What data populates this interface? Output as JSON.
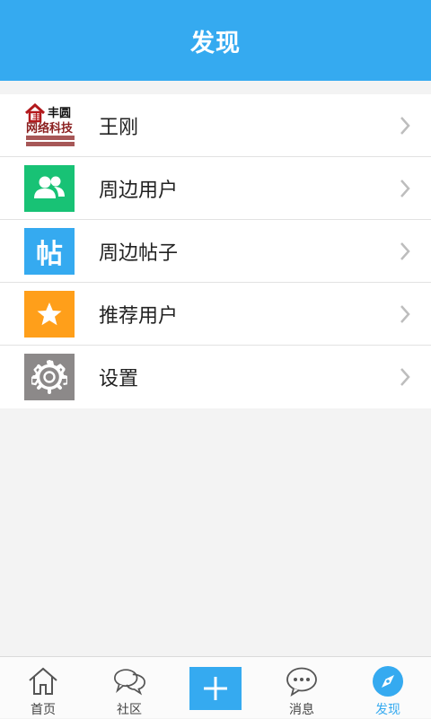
{
  "header": {
    "title": "发现"
  },
  "items": [
    {
      "label": "王刚",
      "icon": "brand-logo-icon",
      "logo_text_1": "丰圆",
      "logo_text_2": "网络科技"
    },
    {
      "label": "周边用户",
      "icon": "users-icon",
      "color": "#18c275"
    },
    {
      "label": "周边帖子",
      "icon": "post-icon",
      "color": "#35aaf0",
      "icon_text": "帖"
    },
    {
      "label": "推荐用户",
      "icon": "star-icon",
      "color": "#ff9f1a"
    },
    {
      "label": "设置",
      "icon": "gear-icon",
      "color": "#8c8989"
    }
  ],
  "tabbar": {
    "tabs": [
      {
        "label": "首页",
        "icon": "home-icon"
      },
      {
        "label": "社区",
        "icon": "chat-bubbles-icon"
      },
      {
        "label": "",
        "icon": "plus-icon"
      },
      {
        "label": "消息",
        "icon": "message-icon"
      },
      {
        "label": "发现",
        "icon": "compass-icon",
        "active": true
      }
    ]
  },
  "colors": {
    "accent": "#35aaf0",
    "background": "#f3f3f3"
  }
}
